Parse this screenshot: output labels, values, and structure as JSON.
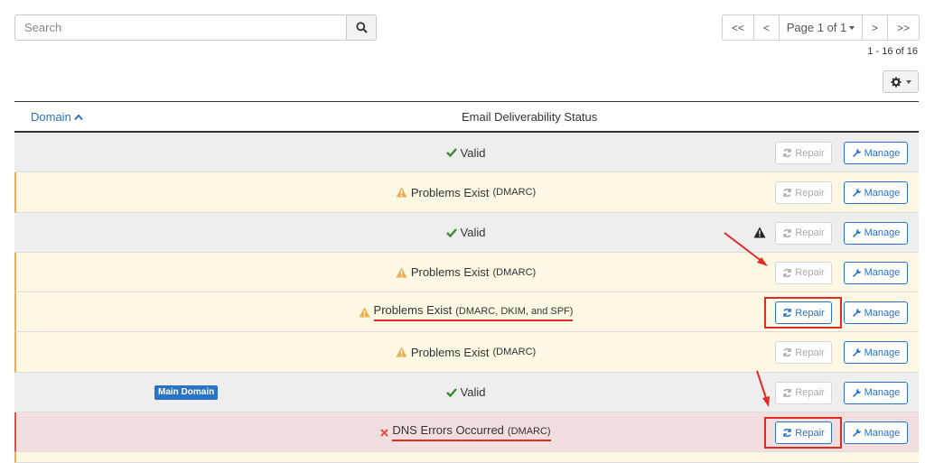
{
  "search": {
    "placeholder": "Search"
  },
  "pagination": {
    "first": "<<",
    "prev": "<",
    "page_label": "Page 1 of 1",
    "next": ">",
    "last": ">>",
    "count": "1 - 16 of 16"
  },
  "table": {
    "columns": {
      "domain": "Domain",
      "status": "Email Deliverability Status"
    },
    "repair_label": "Repair",
    "manage_label": "Manage",
    "rows": [
      {
        "state": "valid",
        "status": "Valid",
        "detail": ""
      },
      {
        "state": "warning",
        "status": "Problems Exist",
        "detail": "(DMARC)"
      },
      {
        "state": "valid",
        "status": "Valid",
        "detail": ""
      },
      {
        "state": "warning",
        "status": "Problems Exist",
        "detail": "(DMARC)"
      },
      {
        "state": "warning",
        "status": "Problems Exist",
        "detail": "(DMARC, DKIM, and SPF)"
      },
      {
        "state": "warning",
        "status": "Problems Exist",
        "detail": "(DMARC)"
      },
      {
        "state": "valid",
        "status": "Valid",
        "detail": "",
        "badge": "Main Domain"
      },
      {
        "state": "error",
        "status": "DNS Errors Occurred",
        "detail": "(DMARC)"
      }
    ]
  },
  "colors": {
    "accent": "#2a72c3",
    "valid": "#3c8a2e",
    "warning": "#f0ad4e",
    "error": "#d9534f",
    "annotation": "#e02b27"
  }
}
